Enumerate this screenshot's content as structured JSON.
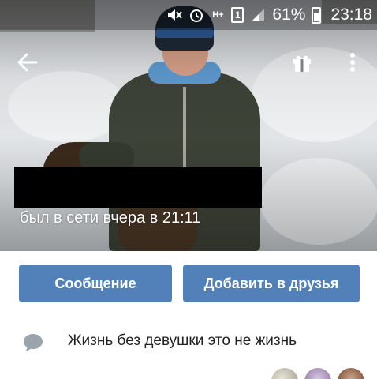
{
  "status_bar": {
    "battery_percent": "61%",
    "time": "23:18",
    "sim_label": "1",
    "network_label": "H+",
    "icons": [
      "mute-icon",
      "alarm-icon",
      "network-icon",
      "sim-icon",
      "signal-icon",
      "battery-icon"
    ]
  },
  "header": {
    "back_icon": "arrow-left-icon",
    "gift_icon": "gift-icon",
    "more_icon": "more-vertical-icon"
  },
  "profile": {
    "last_seen": "был в сети вчера в 21:11"
  },
  "actions": {
    "message_label": "Сообщение",
    "add_friend_label": "Добавить в друзья"
  },
  "status": {
    "icon": "speech-bubble-icon",
    "text": "Жизнь без девушки это не жизнь"
  },
  "colors": {
    "accent": "#5181b8",
    "status_icon": "#9aa4ad"
  }
}
